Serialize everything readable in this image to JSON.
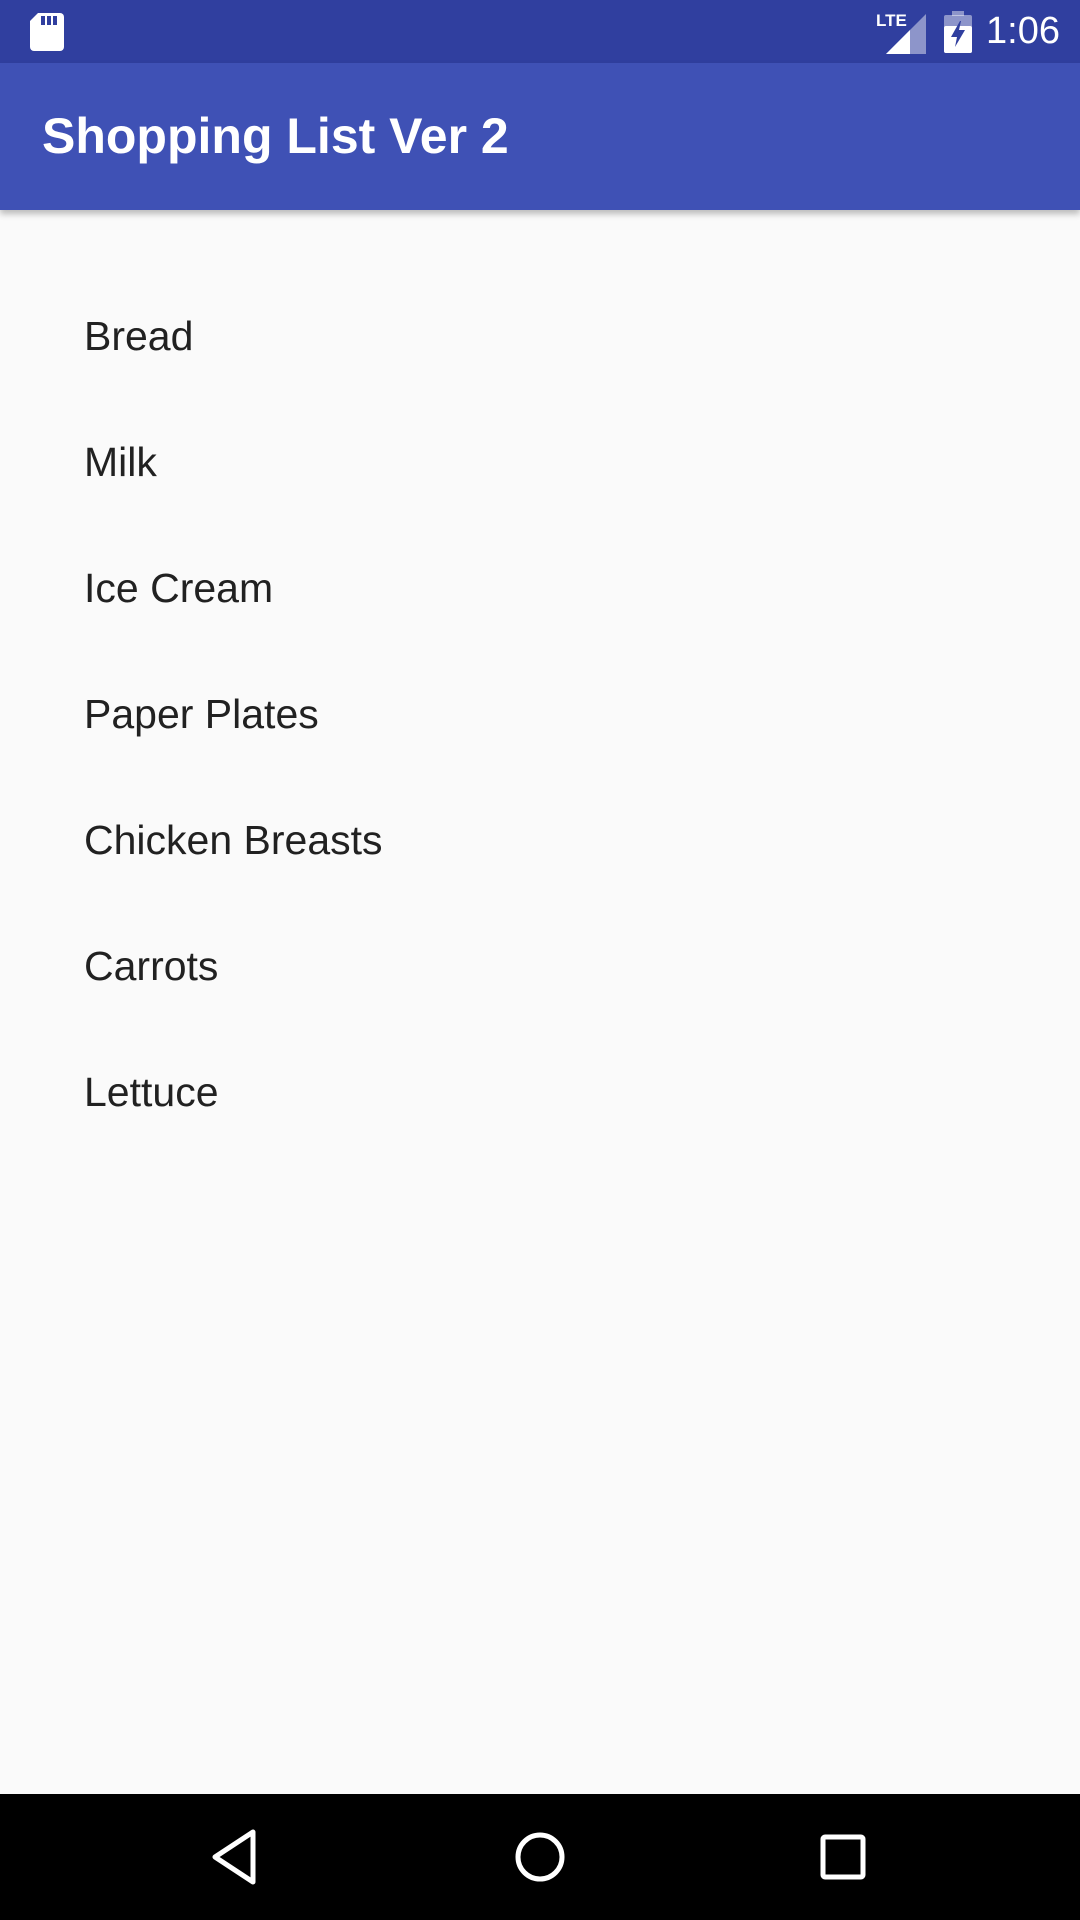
{
  "status_bar": {
    "time": "1:06",
    "network": "LTE",
    "icons": [
      "sd-card-icon",
      "lte-signal-icon",
      "battery-charging-icon"
    ]
  },
  "app_bar": {
    "title": "Shopping List Ver 2",
    "color": "#3f51b5",
    "status_color": "#303f9f"
  },
  "list": {
    "items": [
      {
        "label": "Bread"
      },
      {
        "label": "Milk"
      },
      {
        "label": "Ice Cream"
      },
      {
        "label": "Paper Plates"
      },
      {
        "label": "Chicken Breasts"
      },
      {
        "label": "Carrots"
      },
      {
        "label": "Lettuce"
      }
    ]
  },
  "nav_bar": {
    "icons": [
      "back-icon",
      "home-icon",
      "recents-icon"
    ]
  }
}
